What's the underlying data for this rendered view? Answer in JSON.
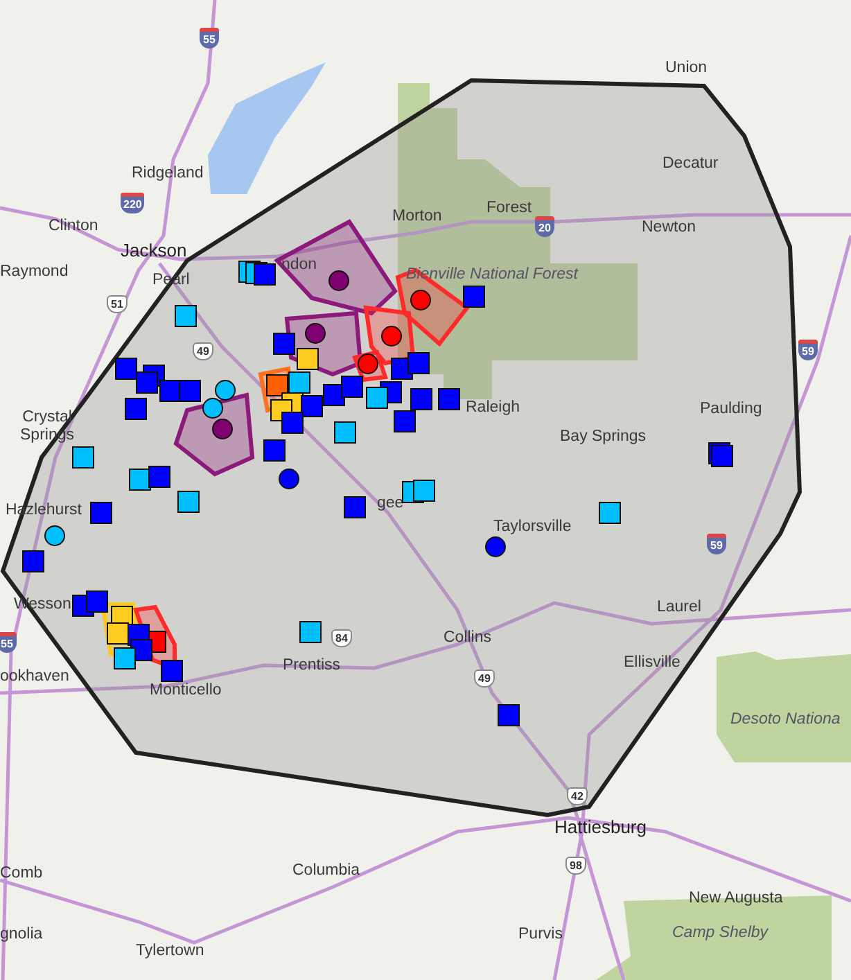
{
  "map": {
    "places": [
      {
        "name": "Ridgeland",
        "kind": "town"
      },
      {
        "name": "Clinton",
        "kind": "town"
      },
      {
        "name": "Jackson",
        "kind": "city"
      },
      {
        "name": "Raymond",
        "kind": "town"
      },
      {
        "name": "Pearl",
        "kind": "town"
      },
      {
        "name": "ndon",
        "kind": "town"
      },
      {
        "name": "Morton",
        "kind": "town"
      },
      {
        "name": "Forest",
        "kind": "town"
      },
      {
        "name": "Union",
        "kind": "town"
      },
      {
        "name": "Decatur",
        "kind": "town"
      },
      {
        "name": "Newton",
        "kind": "town"
      },
      {
        "name": "Bienville National Forest",
        "kind": "park"
      },
      {
        "name": "Crystal Springs",
        "kind": "town"
      },
      {
        "name": "Raleigh",
        "kind": "town"
      },
      {
        "name": "Bay Springs",
        "kind": "town"
      },
      {
        "name": "Paulding",
        "kind": "town"
      },
      {
        "name": "Hazlehurst",
        "kind": "town"
      },
      {
        "name": "gee",
        "kind": "town"
      },
      {
        "name": "Taylorsville",
        "kind": "town"
      },
      {
        "name": "Wesson",
        "kind": "town"
      },
      {
        "name": "ookhaven",
        "kind": "town"
      },
      {
        "name": "Monticello",
        "kind": "town"
      },
      {
        "name": "Prentiss",
        "kind": "town"
      },
      {
        "name": "Collins",
        "kind": "town"
      },
      {
        "name": "Laurel",
        "kind": "town"
      },
      {
        "name": "Ellisville",
        "kind": "town"
      },
      {
        "name": "Desoto Nationa",
        "kind": "park"
      },
      {
        "name": "Hattiesburg",
        "kind": "city"
      },
      {
        "name": "Comb",
        "kind": "town"
      },
      {
        "name": "Columbia",
        "kind": "town"
      },
      {
        "name": "New Augusta",
        "kind": "town"
      },
      {
        "name": "gnolia",
        "kind": "town"
      },
      {
        "name": "Purvis",
        "kind": "town"
      },
      {
        "name": "Camp Shelby",
        "kind": "park"
      },
      {
        "name": "Tylertown",
        "kind": "town"
      }
    ],
    "shields": [
      {
        "number": "55",
        "kind": "interstate"
      },
      {
        "number": "220",
        "kind": "interstate"
      },
      {
        "number": "51",
        "kind": "us"
      },
      {
        "number": "49",
        "kind": "us"
      },
      {
        "number": "20",
        "kind": "interstate"
      },
      {
        "number": "59",
        "kind": "interstate"
      },
      {
        "number": "59",
        "kind": "interstate"
      },
      {
        "number": "84",
        "kind": "us"
      },
      {
        "number": "49",
        "kind": "us"
      },
      {
        "number": "55",
        "kind": "interstate"
      },
      {
        "number": "42",
        "kind": "us"
      },
      {
        "number": "98",
        "kind": "us"
      }
    ],
    "zones": [
      {
        "color": "#8b1a7a"
      },
      {
        "color": "#8b1a7a"
      },
      {
        "color": "#8b1a7a"
      },
      {
        "color": "#ff2a2a"
      },
      {
        "color": "#ff2a2a"
      },
      {
        "color": "#ff2a2a"
      },
      {
        "color": "#ff7020"
      },
      {
        "color": "#ffc820"
      },
      {
        "color": "#ff2a2a"
      }
    ],
    "markers": [
      {
        "kind": "square",
        "color": "#00bfff"
      },
      {
        "kind": "square",
        "color": "#00bfff"
      },
      {
        "kind": "square",
        "color": "#0000ff"
      },
      {
        "kind": "square",
        "color": "#00bfff"
      },
      {
        "kind": "square",
        "color": "#0000ff"
      },
      {
        "kind": "square",
        "color": "#ffcc22"
      },
      {
        "kind": "square",
        "color": "#0000ff"
      },
      {
        "kind": "square",
        "color": "#0000ff"
      },
      {
        "kind": "square",
        "color": "#0000ff"
      },
      {
        "kind": "square",
        "color": "#0000ff"
      },
      {
        "kind": "square",
        "color": "#0000ff"
      },
      {
        "kind": "square",
        "color": "#0000ff"
      },
      {
        "kind": "circle",
        "color": "#00bfff"
      },
      {
        "kind": "circle",
        "color": "#00bfff"
      },
      {
        "kind": "circle",
        "color": "#800070"
      },
      {
        "kind": "square",
        "color": "#ff6000"
      },
      {
        "kind": "square",
        "color": "#00bfff"
      },
      {
        "kind": "square",
        "color": "#ffcc22"
      },
      {
        "kind": "square",
        "color": "#ffcc22"
      },
      {
        "kind": "square",
        "color": "#0000ff"
      },
      {
        "kind": "square",
        "color": "#0000ff"
      },
      {
        "kind": "square",
        "color": "#0000ff"
      },
      {
        "kind": "square",
        "color": "#0000ff"
      },
      {
        "kind": "square",
        "color": "#0000ff"
      },
      {
        "kind": "square",
        "color": "#0000ff"
      },
      {
        "kind": "square",
        "color": "#0000ff"
      },
      {
        "kind": "square",
        "color": "#00bfff"
      },
      {
        "kind": "square",
        "color": "#0000ff"
      },
      {
        "kind": "square",
        "color": "#0000ff"
      },
      {
        "kind": "square",
        "color": "#0000ff"
      },
      {
        "kind": "square",
        "color": "#00bfff"
      },
      {
        "kind": "square",
        "color": "#0000ff"
      },
      {
        "kind": "circle",
        "color": "#0000ff"
      },
      {
        "kind": "square",
        "color": "#00bfff"
      },
      {
        "kind": "square",
        "color": "#00bfff"
      },
      {
        "kind": "square",
        "color": "#0000ff"
      },
      {
        "kind": "square",
        "color": "#00bfff"
      },
      {
        "kind": "square",
        "color": "#0000ff"
      },
      {
        "kind": "circle",
        "color": "#00bfff"
      },
      {
        "kind": "square",
        "color": "#0000ff"
      },
      {
        "kind": "square",
        "color": "#0000ff"
      },
      {
        "kind": "square",
        "color": "#00bfff"
      },
      {
        "kind": "square",
        "color": "#00bfff"
      },
      {
        "kind": "circle",
        "color": "#ff0000"
      },
      {
        "kind": "circle",
        "color": "#ff0000"
      },
      {
        "kind": "circle",
        "color": "#ff0000"
      },
      {
        "kind": "circle",
        "color": "#800070"
      },
      {
        "kind": "circle",
        "color": "#800070"
      },
      {
        "kind": "square",
        "color": "#0000ff"
      },
      {
        "kind": "square",
        "color": "#0000ff"
      },
      {
        "kind": "square",
        "color": "#0000ff"
      },
      {
        "kind": "square",
        "color": "#00bfff"
      },
      {
        "kind": "circle",
        "color": "#0000ff"
      },
      {
        "kind": "square",
        "color": "#0000ff"
      },
      {
        "kind": "square",
        "color": "#0000ff"
      },
      {
        "kind": "square",
        "color": "#ffcc22"
      },
      {
        "kind": "square",
        "color": "#ffcc22"
      },
      {
        "kind": "square",
        "color": "#ff0000"
      },
      {
        "kind": "square",
        "color": "#0000ff"
      },
      {
        "kind": "square",
        "color": "#0000ff"
      },
      {
        "kind": "square",
        "color": "#00bfff"
      },
      {
        "kind": "square",
        "color": "#0000ff"
      },
      {
        "kind": "square",
        "color": "#00bfff"
      },
      {
        "kind": "square",
        "color": "#0000ff"
      }
    ]
  }
}
